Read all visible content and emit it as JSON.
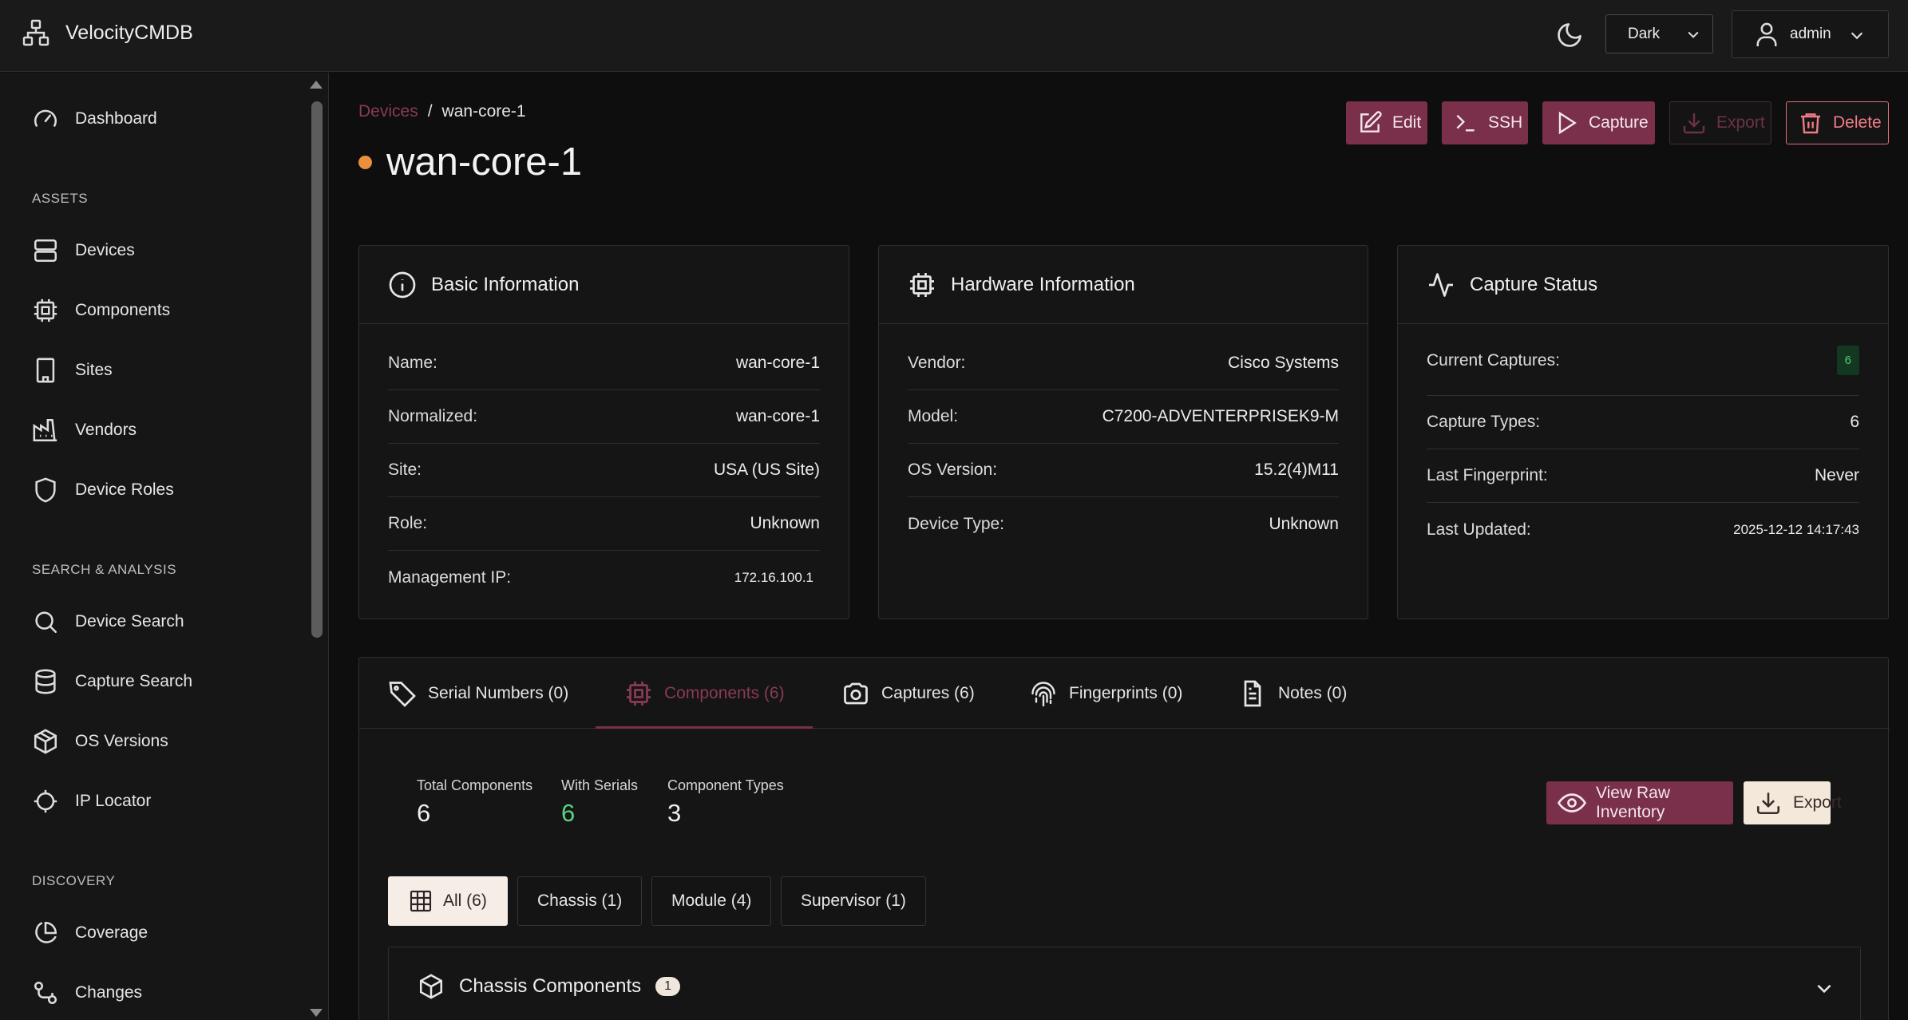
{
  "app": {
    "brand": "VelocityCMDB",
    "theme_value": "Dark",
    "user": "admin"
  },
  "sidebar": {
    "items": [
      {
        "label": "Dashboard",
        "icon": "gauge-icon"
      },
      {
        "label": "Devices",
        "icon": "server-icon"
      },
      {
        "label": "Components",
        "icon": "chip-icon"
      },
      {
        "label": "Sites",
        "icon": "building-icon"
      },
      {
        "label": "Vendors",
        "icon": "factory-icon"
      },
      {
        "label": "Device Roles",
        "icon": "shield-icon"
      },
      {
        "label": "Device Search",
        "icon": "search-icon"
      },
      {
        "label": "Capture Search",
        "icon": "database-icon"
      },
      {
        "label": "OS Versions",
        "icon": "package-icon"
      },
      {
        "label": "IP Locator",
        "icon": "crosshair-icon"
      },
      {
        "label": "Coverage",
        "icon": "pie-chart-icon"
      },
      {
        "label": "Changes",
        "icon": "git-compare-icon"
      }
    ],
    "sections": {
      "assets": "ASSETS",
      "search": "SEARCH & ANALYSIS",
      "discovery": "DISCOVERY"
    }
  },
  "breadcrumb": {
    "parent": "Devices",
    "separator": "/",
    "current": "wan-core-1"
  },
  "page": {
    "title": "wan-core-1",
    "status_color": "#e8913a"
  },
  "actions": {
    "edit": "Edit",
    "ssh": "SSH",
    "capture": "Capture",
    "export": "Export",
    "delete": "Delete"
  },
  "basic_info": {
    "title": "Basic Information",
    "rows": [
      {
        "label": "Name:",
        "value": "wan-core-1"
      },
      {
        "label": "Normalized:",
        "value": "wan-core-1"
      },
      {
        "label": "Site:",
        "value": "USA (US Site)"
      },
      {
        "label": "Role:",
        "value": "Unknown"
      },
      {
        "label": "Management IP:",
        "value": "172.16.100.1"
      }
    ]
  },
  "hardware_info": {
    "title": "Hardware Information",
    "rows": [
      {
        "label": "Vendor:",
        "value": "Cisco Systems"
      },
      {
        "label": "Model:",
        "value": "C7200-ADVENTERPRISEK9-M"
      },
      {
        "label": "OS Version:",
        "value": "15.2(4)M11"
      },
      {
        "label": "Device Type:",
        "value": "Unknown"
      }
    ]
  },
  "capture_status": {
    "title": "Capture Status",
    "rows": [
      {
        "label": "Current Captures:",
        "value": "6"
      },
      {
        "label": "Capture Types:",
        "value": "6"
      },
      {
        "label": "Last Fingerprint:",
        "value": "Never"
      },
      {
        "label": "Last Updated:",
        "value": "2025-12-12 14:17:43"
      }
    ]
  },
  "tabs": [
    {
      "label": "Serial Numbers (0)",
      "icon": "tag-icon"
    },
    {
      "label": "Components (6)",
      "icon": "chip-icon",
      "active": true
    },
    {
      "label": "Captures (6)",
      "icon": "camera-icon"
    },
    {
      "label": "Fingerprints (0)",
      "icon": "fingerprint-icon"
    },
    {
      "label": "Notes (0)",
      "icon": "file-text-icon"
    }
  ],
  "components": {
    "stats": [
      {
        "label": "Total Components",
        "value": "6"
      },
      {
        "label": "With Serials",
        "value": "6"
      },
      {
        "label": "Component Types",
        "value": "3"
      }
    ],
    "view_raw": "View Raw Inventory",
    "export": "Export",
    "filters": [
      {
        "label": "All (6)",
        "active": true
      },
      {
        "label": "Chassis (1)"
      },
      {
        "label": "Module (4)"
      },
      {
        "label": "Supervisor (1)"
      }
    ],
    "accordion": {
      "title": "Chassis Components",
      "count": "1"
    }
  },
  "colors": {
    "accent": "#7a2f4a",
    "success": "#59d47f",
    "danger": "#f07b86",
    "background": "#0e0e0e"
  }
}
